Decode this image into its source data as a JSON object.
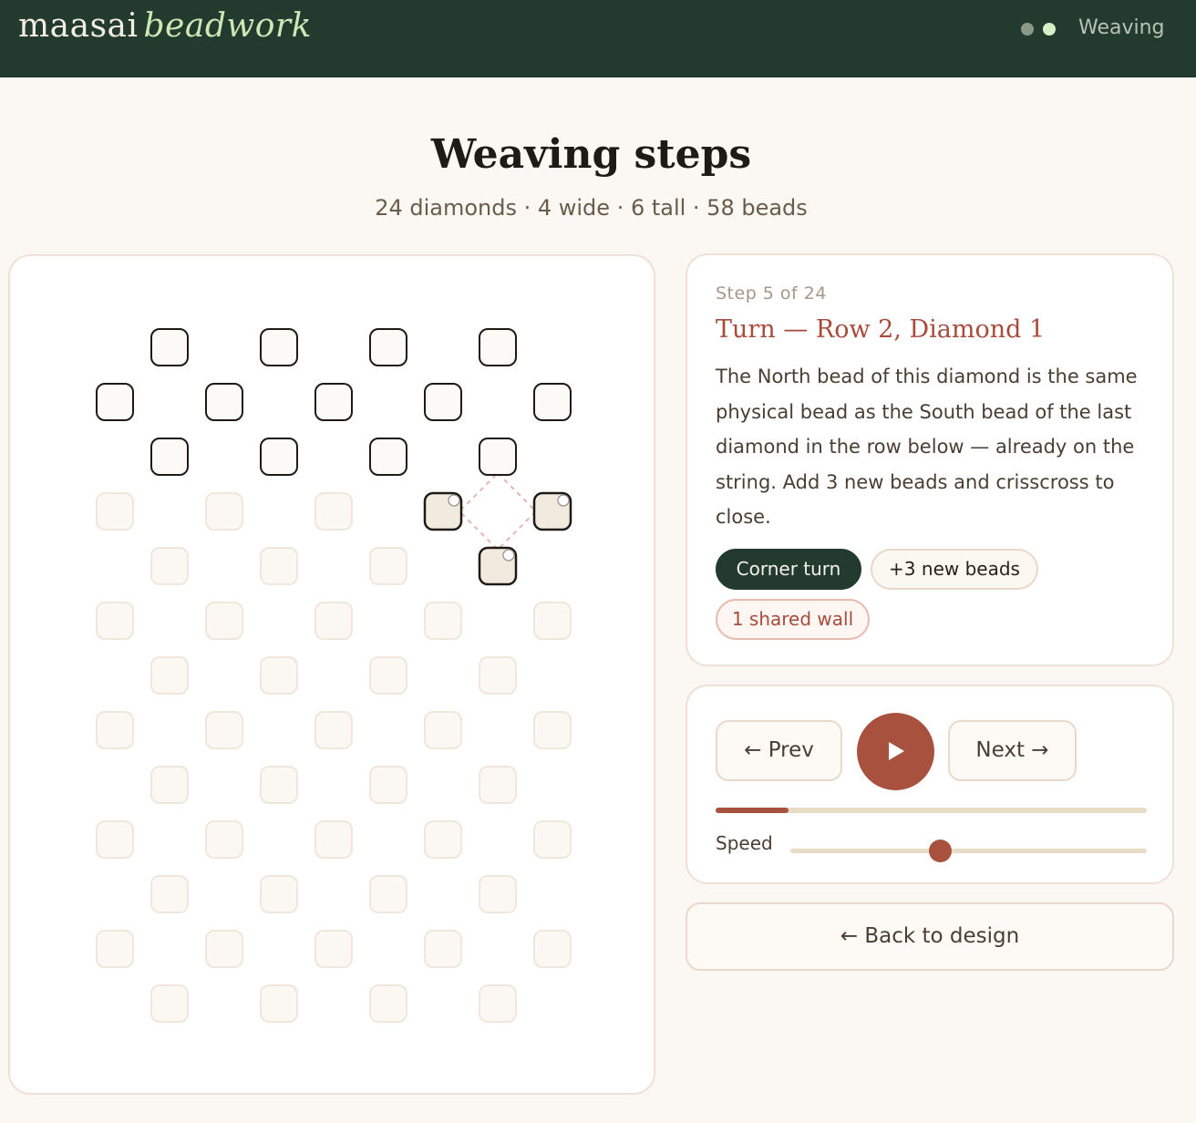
{
  "header": {
    "brand_main": "maasai",
    "brand_accent": "beadwork",
    "nav_label": "Weaving",
    "colors": {
      "bar": "#233a2e",
      "accent": "#cfe6b5"
    }
  },
  "page": {
    "title": "Weaving steps",
    "subtitle": "24 diamonds · 4 wide · 6 tall · 58 beads"
  },
  "step": {
    "label": "Step 5 of 24",
    "title": "Turn — Row 2, Diamond 1",
    "description": "The North bead of this diamond is the same physical bead as the South bead of the last diamond in the row below — already on the string. Add 3 new beads and crisscross to close.",
    "tags": {
      "corner": "Corner turn",
      "new_beads": "+3 new beads",
      "shared": "1 shared wall"
    }
  },
  "controls": {
    "prev_label": "← Prev",
    "next_label": "Next →",
    "play_icon": "play-icon",
    "progress": 0.17,
    "speed_label": "Speed",
    "speed": 0.42
  },
  "back_label": "← Back to design",
  "pattern": {
    "diamonds_wide": 4,
    "diamonds_tall": 6,
    "placed_rows": 3,
    "current_diamond": {
      "row": 2,
      "col": 4
    },
    "colors": {
      "placed_fill": "#fbfaf6",
      "placed_stroke": "#1f1a15",
      "empty_fill": "#fbf8f3",
      "empty_stroke": "#efe7dc",
      "current_fill": "#f1eadf",
      "guide": "#e3b7ae"
    }
  }
}
